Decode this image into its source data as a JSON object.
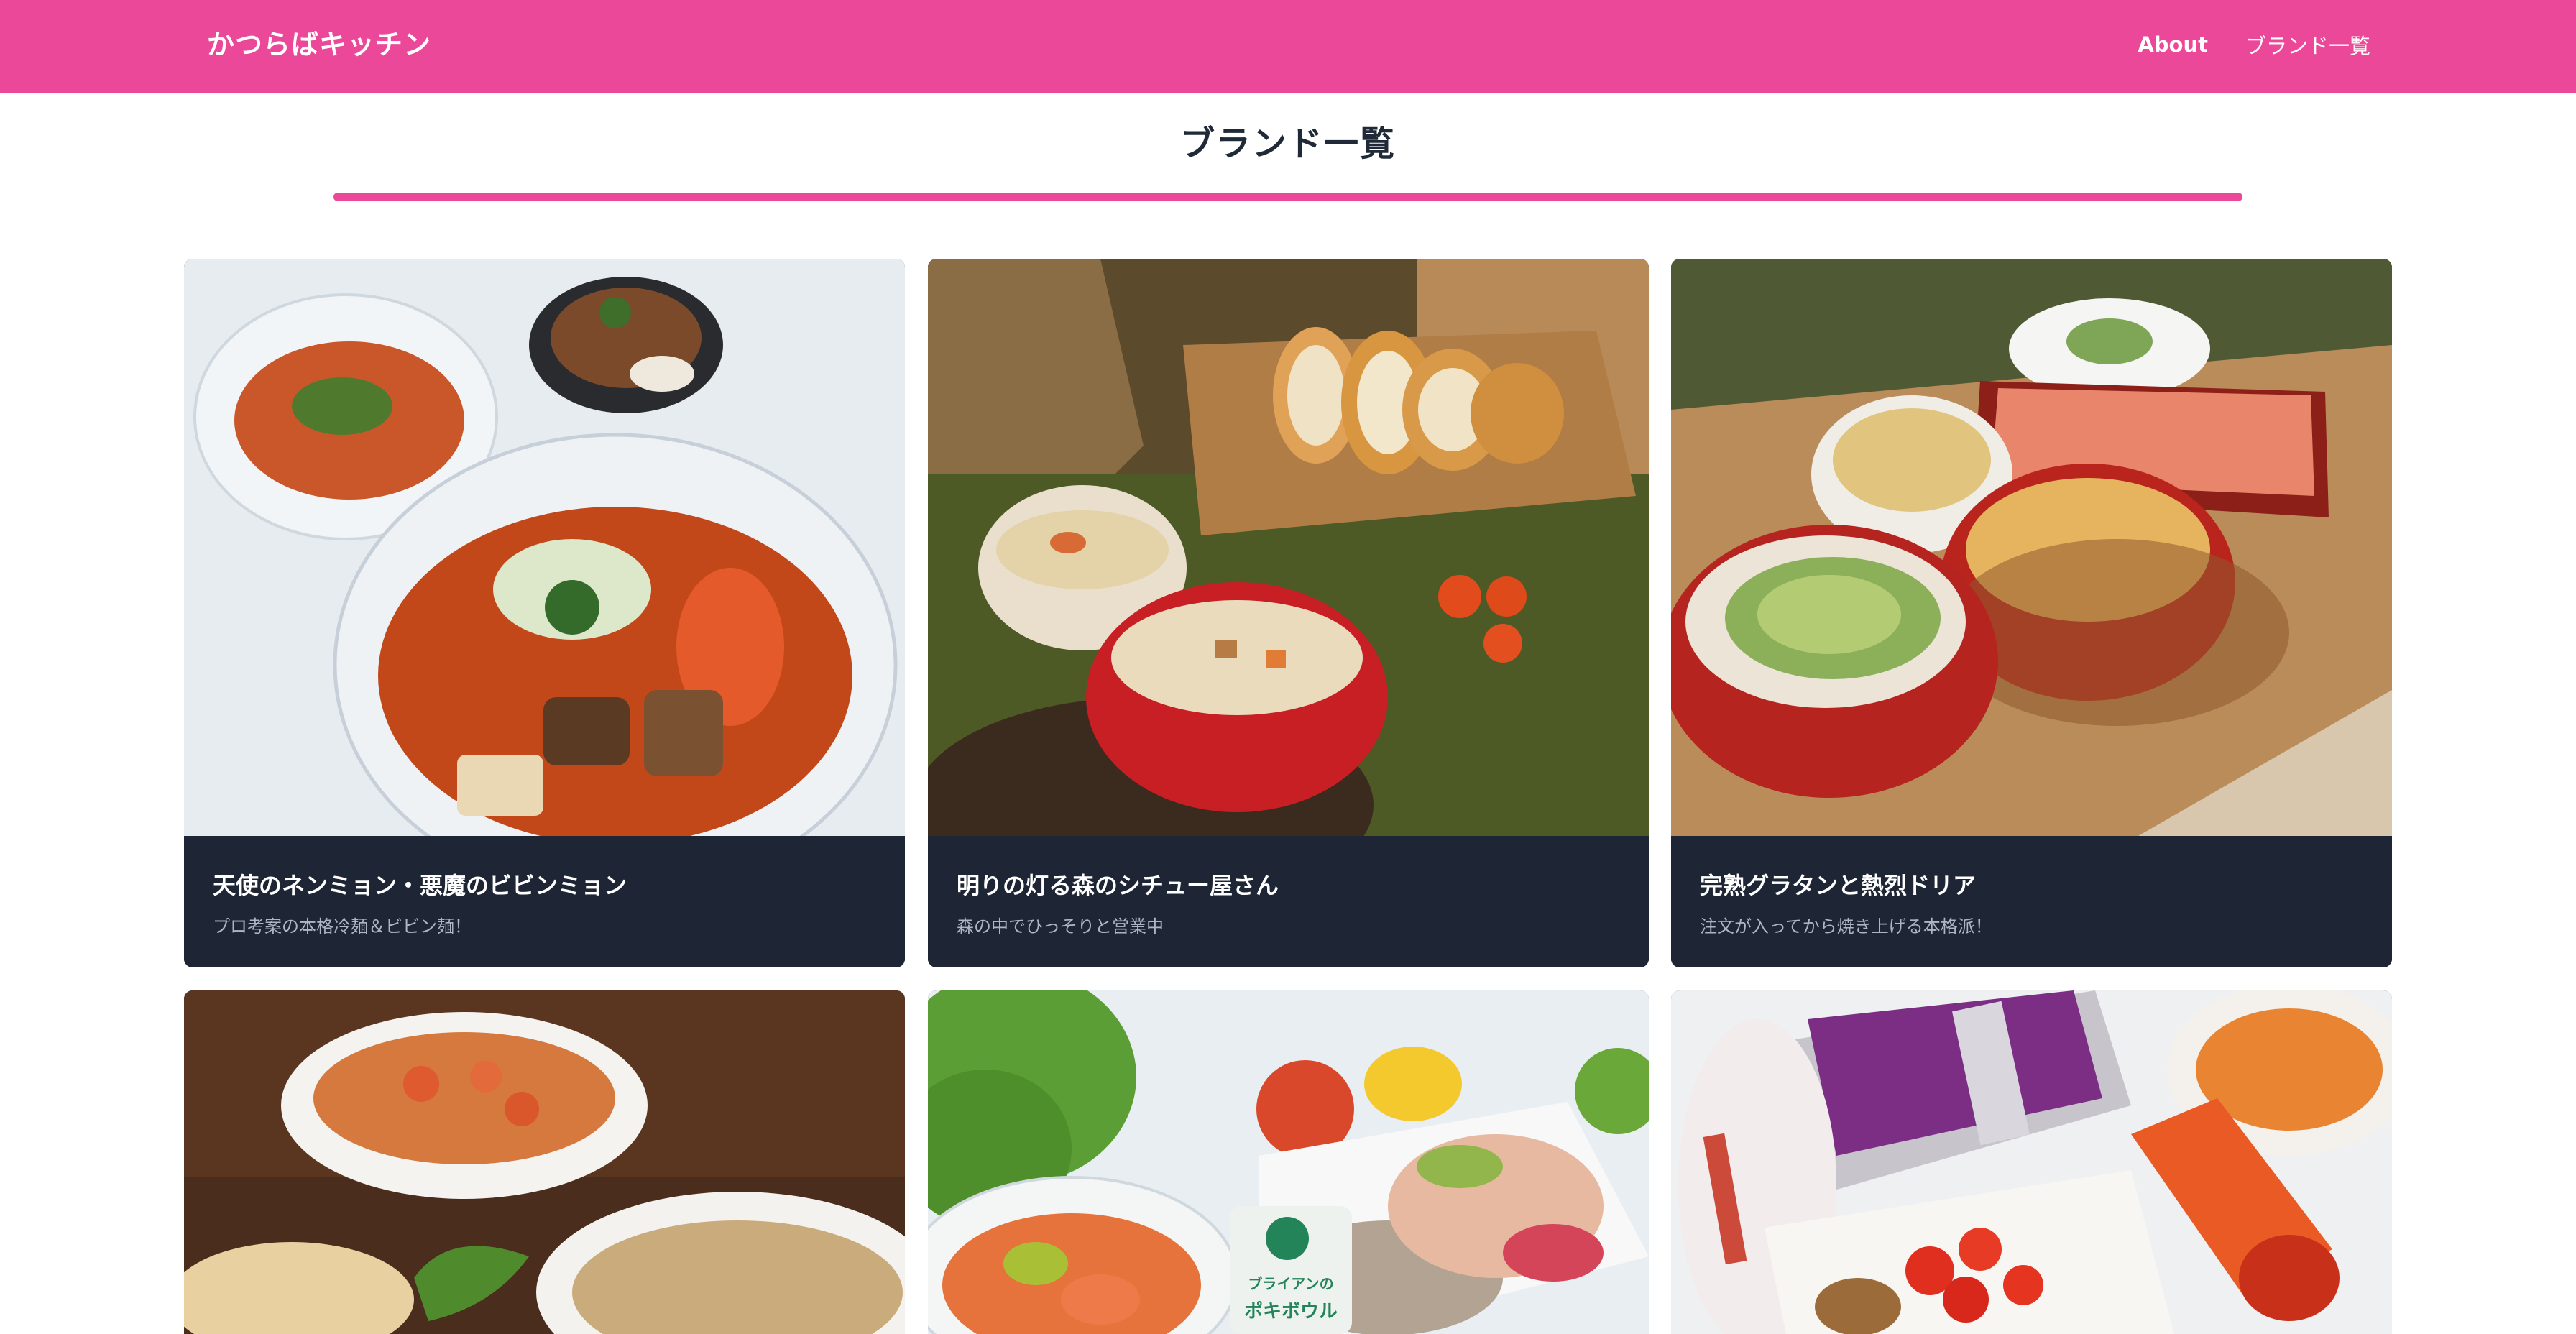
{
  "header": {
    "brand": "かつらばキッチン",
    "nav": [
      {
        "label": "About"
      },
      {
        "label": "ブランド一覧"
      }
    ],
    "accent_color": "#ec4899"
  },
  "main": {
    "title": "ブランド一覧",
    "brands": [
      {
        "name": "天使のネンミョン・悪魔のビビンミョン",
        "description": "プロ考案の本格冷麺＆ビビン麺！",
        "image": "cold-noodle-bowls-photo"
      },
      {
        "name": "明りの灯る森のシチュー屋さん",
        "description": "森の中でひっそりと営業中",
        "image": "stew-and-baguette-photo"
      },
      {
        "name": "完熟グラタンと熱烈ドリア",
        "description": "注文が入ってから焼き上げる本格派！",
        "image": "gratin-and-doria-photo"
      },
      {
        "name": "",
        "description": "",
        "image": "tomato-doria-photo"
      },
      {
        "name": "",
        "description": "",
        "image": "poke-bowl-photo",
        "logo_text": [
          "ブライアンの",
          "ポキボウル"
        ]
      },
      {
        "name": "",
        "description": "",
        "image": "spicy-dishes-photo"
      }
    ],
    "card_footer_color": "#1e2635"
  }
}
